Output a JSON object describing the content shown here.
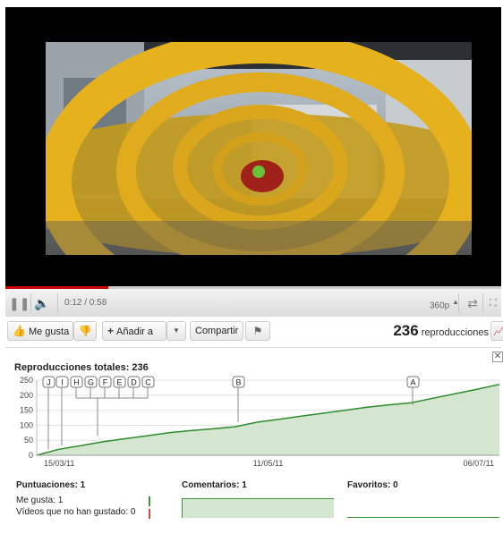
{
  "player": {
    "time": "0:12 / 0:58",
    "quality": "360p",
    "progress": 0.207
  },
  "actions": {
    "like_label": "Me gusta",
    "add_label": "Añadir a",
    "share_label": "Compartir",
    "view_count": "236",
    "views_label": "reproducciones"
  },
  "stats": {
    "title": "Reproducciones totales: 236",
    "ratings_title": "Puntuaciones: 1",
    "likes_line": "Me gusta: 1",
    "dislikes_line": "Vídeos que no han gustado: 0",
    "comments_title": "Comentarios: 1",
    "favorites_title": "Favoritos: 0"
  },
  "chart_data": {
    "type": "area",
    "x": [
      "15/03/11",
      "11/05/11",
      "06/07/11"
    ],
    "x_ticks": [
      "15/03/11",
      "11/05/11",
      "06/07/11"
    ],
    "yticks": [
      0,
      50,
      100,
      150,
      200,
      250
    ],
    "ylim": [
      0,
      250
    ],
    "series": [
      {
        "values": [
          0,
          20,
          32,
          45,
          55,
          65,
          75,
          82,
          88,
          95,
          110,
          120,
          130,
          140,
          150,
          160,
          168,
          175,
          190,
          205,
          220,
          236
        ]
      }
    ],
    "markers": [
      "J",
      "I",
      "H",
      "G",
      "F",
      "E",
      "D",
      "C",
      "B",
      "A"
    ],
    "fill_color": "#d4e6cf",
    "line_color": "#2e8b2e"
  }
}
